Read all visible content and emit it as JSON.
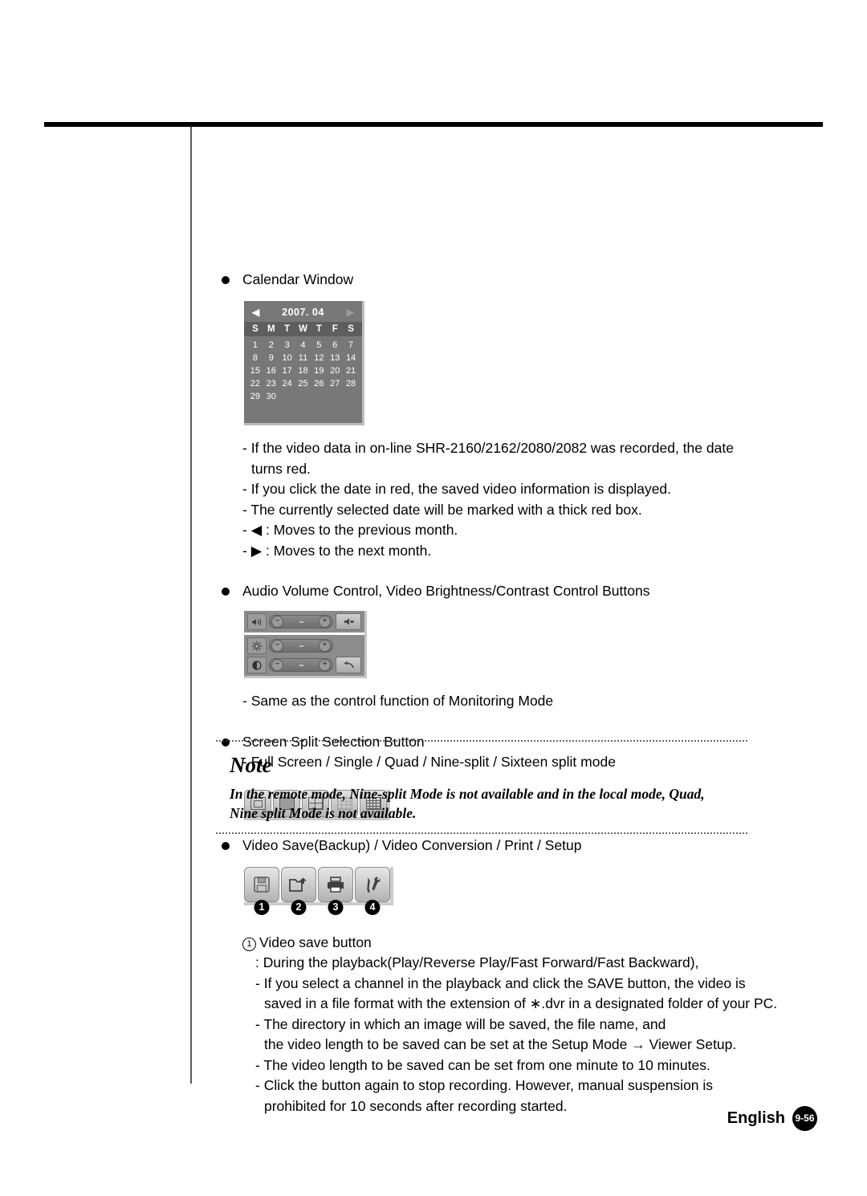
{
  "sections": {
    "calendar": {
      "heading": "Calendar Window",
      "widget": {
        "prev_arrow": "◀",
        "next_arrow": "▶",
        "title": "2007.  04",
        "day_headers": [
          "S",
          "M",
          "T",
          "W",
          "T",
          "F",
          "S"
        ],
        "days": [
          "1",
          "2",
          "3",
          "4",
          "5",
          "6",
          "7",
          "8",
          "9",
          "10",
          "11",
          "12",
          "13",
          "14",
          "15",
          "16",
          "17",
          "18",
          "19",
          "20",
          "21",
          "22",
          "23",
          "24",
          "25",
          "26",
          "27",
          "28",
          "29",
          "30"
        ]
      },
      "notes": [
        "- If the video data in on-line SHR-2160/2162/2080/2082 was recorded, the date",
        "turns red.",
        "- If you click the date in red, the saved video information is displayed.",
        "- The currently selected date will be marked with a thick red box.",
        "- ◀ : Moves to the previous month.",
        "- ▶ : Moves to the next month."
      ]
    },
    "av_control": {
      "heading": "Audio Volume Control, Video Brightness/Contrast Control Buttons",
      "rows": [
        {
          "icon": "speaker-icon",
          "minus": "−",
          "plus": "+",
          "action": "mute-button"
        },
        {
          "icon": "brightness-icon",
          "minus": "−",
          "plus": "+",
          "action": "none"
        },
        {
          "icon": "contrast-icon",
          "minus": "−",
          "plus": "+",
          "action": "reset-button"
        }
      ],
      "note": "- Same as the control function of Monitoring Mode"
    },
    "screen_split": {
      "heading": "Screen Split Selection Button",
      "note": "- Full Screen / Single / Quad / Nine-split / Sixteen split mode",
      "buttons": [
        {
          "name": "full-screen-split-button",
          "mode": "full"
        },
        {
          "name": "single-split-button",
          "mode": "single"
        },
        {
          "name": "quad-split-button",
          "mode": "quad"
        },
        {
          "name": "nine-split-button",
          "mode": "nine"
        },
        {
          "name": "sixteen-split-button",
          "mode": "sixteen"
        }
      ]
    },
    "note_box": {
      "title": "Note",
      "lines": [
        "In the remote mode, Nine-split Mode is not available and in the local mode, Quad,",
        "Nine split Mode is not available."
      ]
    },
    "video_save": {
      "heading": "Video Save(Backup) / Video Conversion / Print / Setup",
      "buttons": [
        {
          "name": "video-save-button",
          "icon": "floppy-disk-icon",
          "number": "1"
        },
        {
          "name": "video-conversion-button",
          "icon": "open-folder-icon",
          "number": "2"
        },
        {
          "name": "print-button",
          "icon": "printer-icon",
          "number": "3"
        },
        {
          "name": "setup-button",
          "icon": "tools-icon",
          "number": "4"
        }
      ],
      "item_number": "1",
      "item_title": "Video save button",
      "details": [
        ": During the playback(Play/Reverse Play/Fast Forward/Fast Backward),",
        "- If you select a channel in the playback and click the SAVE button, the video is",
        "saved in a file format with the extension of ∗.dvr in a designated folder of your PC.",
        "- The directory in which an image will be saved, the file name, and",
        "the video length to be saved can be set at the Setup Mode → Viewer Setup.",
        "- The video length to be saved can be set from one minute to 10 minutes.",
        "- Click the button again to stop recording. However, manual suspension is",
        "prohibited for 10 seconds after recording started."
      ]
    }
  },
  "footer": {
    "language": "English",
    "page": "9-56"
  }
}
